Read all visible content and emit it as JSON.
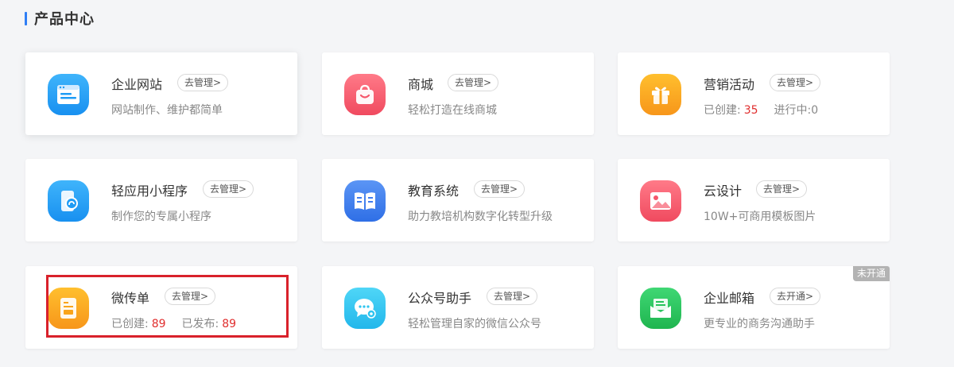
{
  "section": {
    "title": "产品中心"
  },
  "cards": [
    {
      "title": "企业网站",
      "button": "去管理>",
      "desc": "网站制作、维护都简单"
    },
    {
      "title": "商城",
      "button": "去管理>",
      "desc": "轻松打造在线商城"
    },
    {
      "title": "营销活动",
      "button": "去管理>",
      "stat1_label": "已创建:",
      "stat1_value": "35",
      "stat2_label": "进行中:",
      "stat2_value": "0"
    },
    {
      "title": "轻应用小程序",
      "button": "去管理>",
      "desc": "制作您的专属小程序"
    },
    {
      "title": "教育系统",
      "button": "去管理>",
      "desc": "助力教培机构数字化转型升级"
    },
    {
      "title": "云设计",
      "button": "去管理>",
      "desc": "10W+可商用模板图片"
    },
    {
      "title": "微传单",
      "button": "去管理>",
      "stat1_label": "已创建:",
      "stat1_value": "89",
      "stat2_label": "已发布:",
      "stat2_value": "89"
    },
    {
      "title": "公众号助手",
      "button": "去管理>",
      "desc": "轻松管理自家的微信公众号"
    },
    {
      "title": "企业邮箱",
      "button": "去开通>",
      "desc": "更专业的商务沟通助手",
      "tag": "未开通"
    }
  ],
  "icons": {
    "website": {
      "name": "website-icon",
      "color": "#1e9cf5"
    },
    "mall": {
      "name": "shopping-bag-icon",
      "color": "#f5566a"
    },
    "marketing": {
      "name": "gift-icon",
      "color": "#f9a41b"
    },
    "miniapp": {
      "name": "mini-program-icon",
      "color": "#1e9cf5"
    },
    "education": {
      "name": "book-icon",
      "color": "#3f7cef"
    },
    "design": {
      "name": "picture-icon",
      "color": "#f5566a"
    },
    "flyer": {
      "name": "flyer-icon",
      "color": "#f9a41b"
    },
    "wechat": {
      "name": "wechat-chat-icon",
      "color": "#2ec5f0"
    },
    "mail": {
      "name": "mail-icon",
      "color": "#27c35b"
    }
  },
  "colors": {
    "accent": "#2f7ef5",
    "number": "#e02e2e",
    "highlight_border": "#d9212b"
  }
}
